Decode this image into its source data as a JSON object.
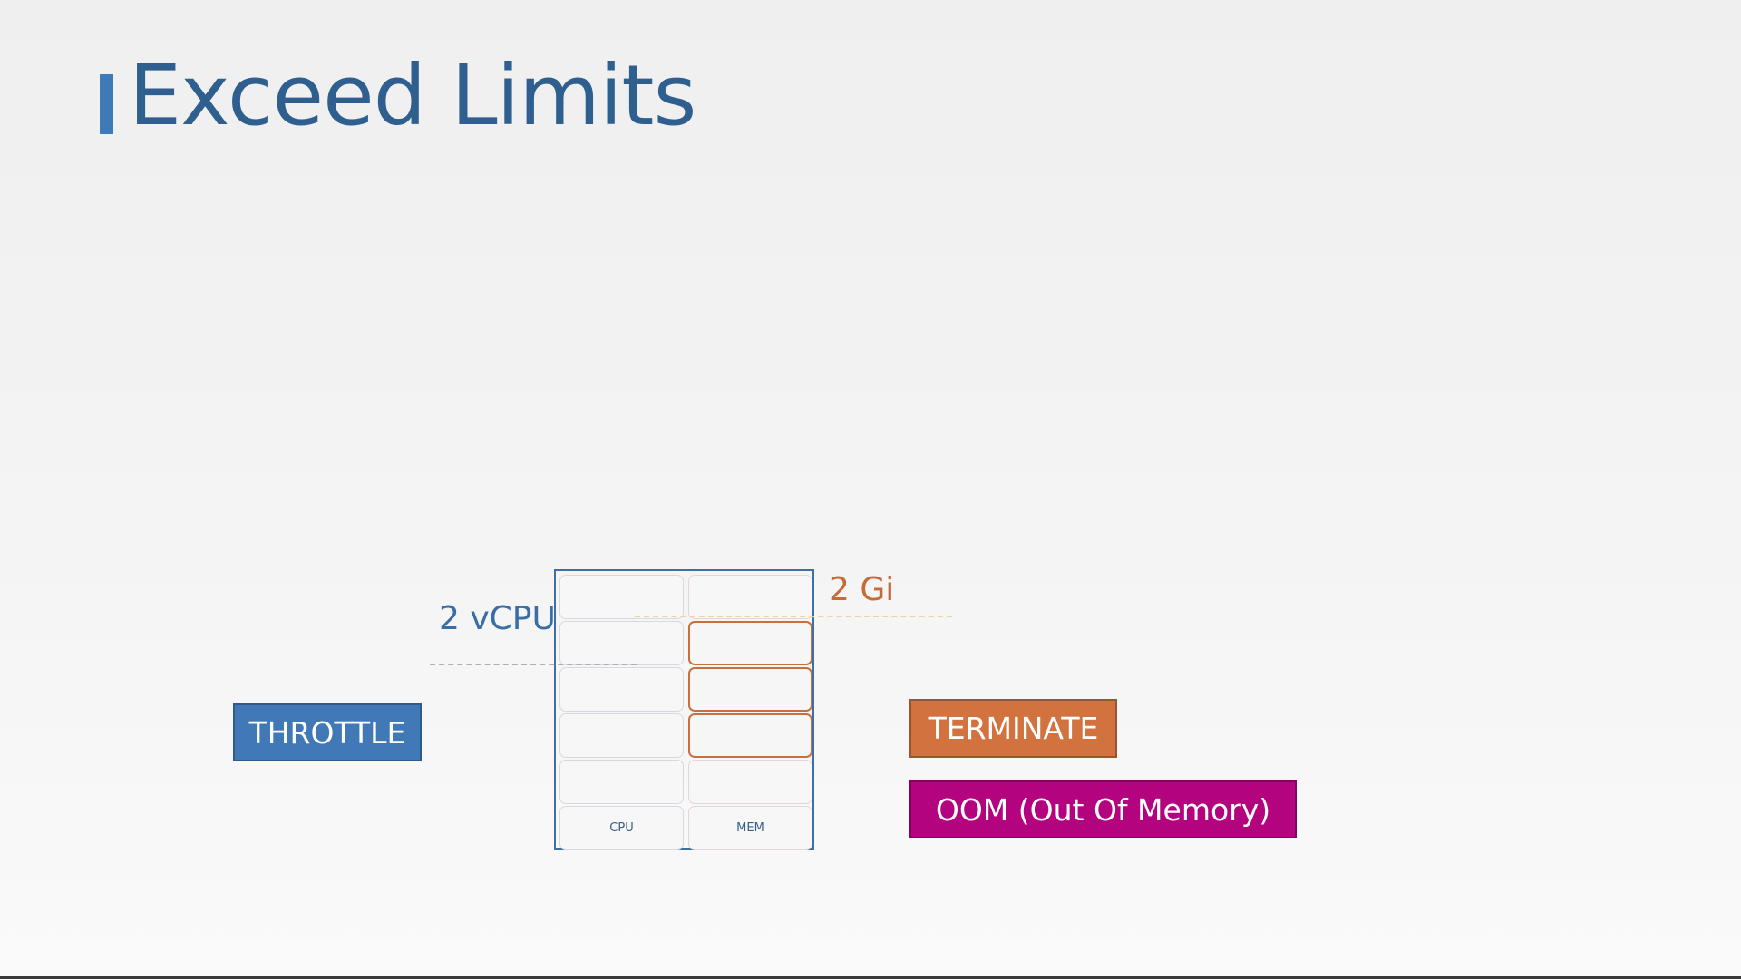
{
  "slide": {
    "title": "Exceed Limits"
  },
  "diagram": {
    "columns": [
      {
        "label": "CPU",
        "limit_label": "2 vCPU",
        "color": "#3a6ea5",
        "used_cells": 0
      },
      {
        "label": "MEM",
        "limit_label": "2 Gi",
        "color": "#c56b38",
        "used_cells": 3
      }
    ],
    "rows": 5
  },
  "actions": {
    "cpu": {
      "label": "THROTTLE",
      "color": "#4179b6"
    },
    "mem_primary": {
      "label": "TERMINATE",
      "color": "#d2733f"
    },
    "mem_secondary": {
      "label": "OOM (Out Of Memory)",
      "color": "#b4037f"
    }
  }
}
